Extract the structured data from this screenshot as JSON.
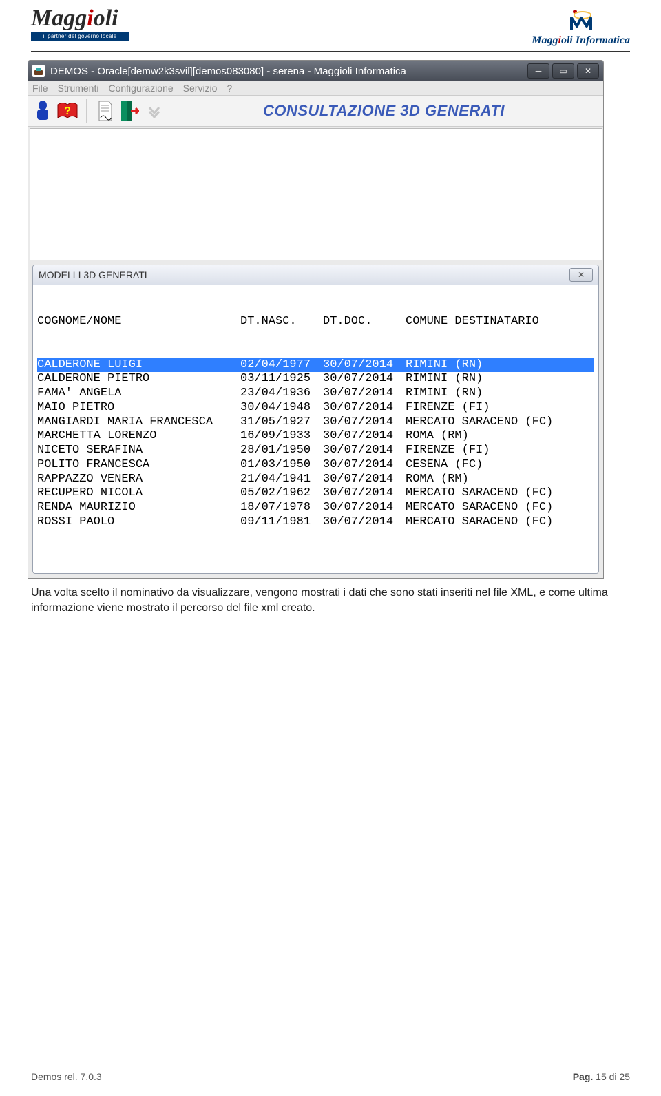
{
  "header": {
    "logo_left_brand_pre": "Magg",
    "logo_left_brand_red": "i",
    "logo_left_brand_post": "oli",
    "tagline": "il partner del governo locale",
    "logo_right_pre": "Magg",
    "logo_right_red": "i",
    "logo_right_post": "oli Informatica"
  },
  "window": {
    "title": "DEMOS - Oracle[demw2k3svil][demos083080] - serena - Maggioli Informatica",
    "menu": [
      "File",
      "Strumenti",
      "Configurazione",
      "Servizio",
      "?"
    ],
    "heading": "CONSULTAZIONE 3D GENERATI"
  },
  "dialog": {
    "title": "MODELLI 3D GENERATI",
    "headers": {
      "cognome": "COGNOME/NOME",
      "nasc": "DT.NASC.",
      "doc": "DT.DOC.",
      "comune": "COMUNE DESTINATARIO"
    },
    "rows": [
      {
        "name": "CALDERONE LUIGI",
        "nasc": "02/04/1977",
        "doc": "30/07/2014",
        "comune": "RIMINI (RN)",
        "selected": true
      },
      {
        "name": "CALDERONE PIETRO",
        "nasc": "03/11/1925",
        "doc": "30/07/2014",
        "comune": "RIMINI (RN)"
      },
      {
        "name": "FAMA' ANGELA",
        "nasc": "23/04/1936",
        "doc": "30/07/2014",
        "comune": "RIMINI (RN)"
      },
      {
        "name": "MAIO PIETRO",
        "nasc": "30/04/1948",
        "doc": "30/07/2014",
        "comune": "FIRENZE (FI)"
      },
      {
        "name": "MANGIARDI MARIA FRANCESCA",
        "nasc": "31/05/1927",
        "doc": "30/07/2014",
        "comune": "MERCATO SARACENO (FC)"
      },
      {
        "name": "MARCHETTA LORENZO",
        "nasc": "16/09/1933",
        "doc": "30/07/2014",
        "comune": "ROMA (RM)"
      },
      {
        "name": "NICETO SERAFINA",
        "nasc": "28/01/1950",
        "doc": "30/07/2014",
        "comune": "FIRENZE (FI)"
      },
      {
        "name": "POLITO FRANCESCA",
        "nasc": "01/03/1950",
        "doc": "30/07/2014",
        "comune": "CESENA (FC)"
      },
      {
        "name": "RAPPAZZO VENERA",
        "nasc": "21/04/1941",
        "doc": "30/07/2014",
        "comune": "ROMA (RM)"
      },
      {
        "name": "RECUPERO NICOLA",
        "nasc": "05/02/1962",
        "doc": "30/07/2014",
        "comune": "MERCATO SARACENO (FC)"
      },
      {
        "name": "RENDA MAURIZIO",
        "nasc": "18/07/1978",
        "doc": "30/07/2014",
        "comune": "MERCATO SARACENO (FC)"
      },
      {
        "name": "ROSSI PAOLO",
        "nasc": "09/11/1981",
        "doc": "30/07/2014",
        "comune": "MERCATO SARACENO (FC)"
      }
    ]
  },
  "body_text": "Una volta scelto il nominativo da visualizzare, vengono mostrati i dati che sono stati inseriti nel file XML, e come ultima informazione viene mostrato il percorso del file xml creato.",
  "footer": {
    "left": "Demos rel. 7.0.3",
    "right_prefix": "Pag. ",
    "right_page": "15 di 25"
  }
}
